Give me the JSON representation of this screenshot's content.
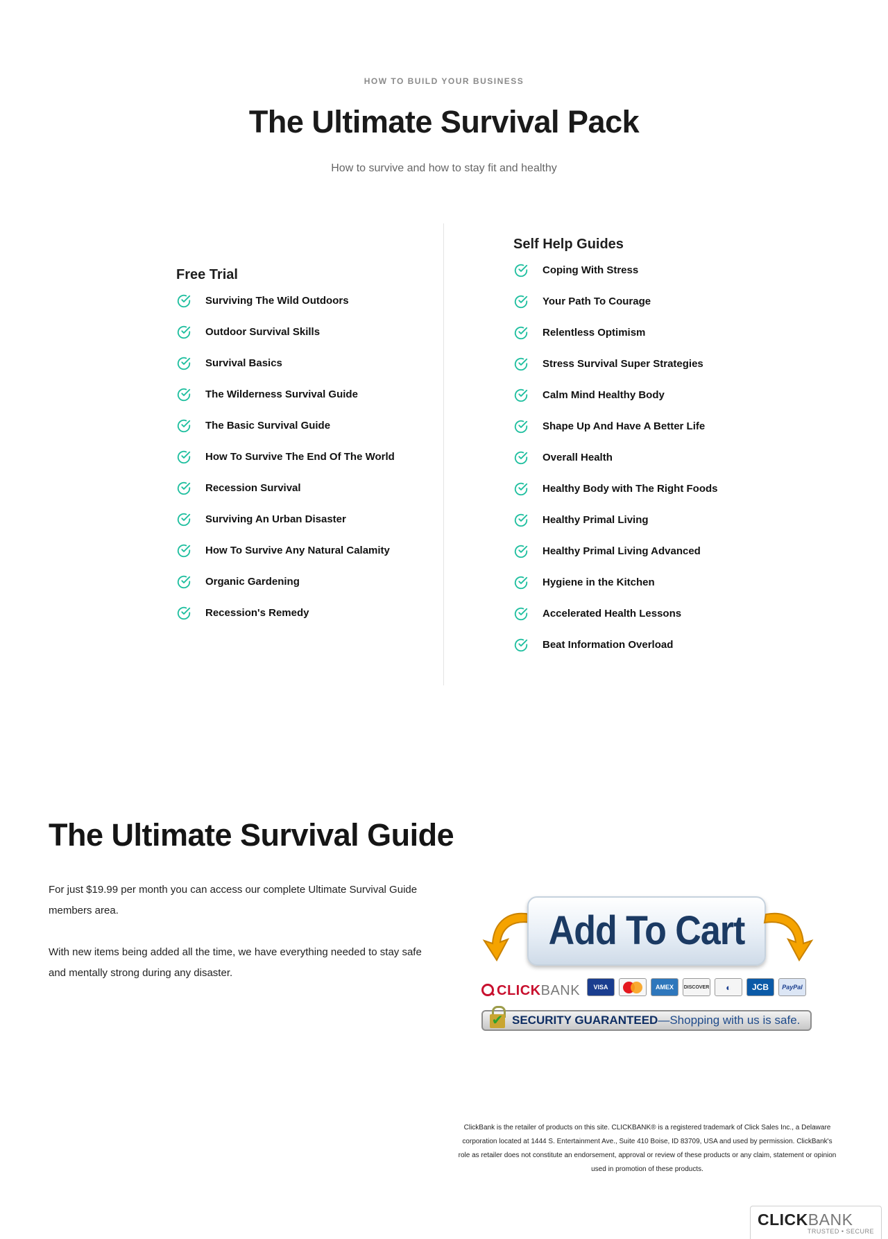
{
  "hero": {
    "eyebrow": "HOW TO BUILD YOUR BUSINESS",
    "title": "The Ultimate Survival Pack",
    "subtitle": "How to survive and how to stay fit and healthy"
  },
  "free_trial": {
    "title": "Free Trial",
    "items": [
      "Surviving The Wild Outdoors",
      "Outdoor Survival Skills",
      "Survival Basics",
      "The Wilderness Survival Guide",
      "The Basic Survival Guide",
      "How To Survive The End Of The World",
      "Recession Survival",
      "Surviving An Urban Disaster",
      "How To Survive Any Natural Calamity",
      "Organic Gardening",
      "Recession's Remedy"
    ]
  },
  "self_help": {
    "title": "Self Help Guides",
    "items": [
      "Coping With Stress",
      "Your Path To Courage",
      "Relentless Optimism",
      "Stress Survival Super Strategies",
      "Calm Mind Healthy Body",
      "Shape Up And Have A Better Life",
      "Overall Health",
      "Healthy Body with The Right Foods",
      "Healthy Primal Living",
      "Healthy Primal Living Advanced",
      "Hygiene in the Kitchen",
      "Accelerated Health Lessons",
      "Beat Information Overload"
    ]
  },
  "guide": {
    "title": "The Ultimate Survival Guide",
    "paragraph1": "For just $19.99 per month you can access our complete Ultimate Survival Guide members area.",
    "paragraph2": "With new items being added all the  time, we have everything needed to stay safe and mentally strong during any disaster."
  },
  "purchase": {
    "button_label": "Add To Cart",
    "clickbank_brand": "CLICK",
    "clickbank_brand_thin": "BANK",
    "cards": [
      "VISA",
      "MasterCard",
      "AMEX",
      "DISCOVER",
      "Diners",
      "JCB",
      "PayPal"
    ],
    "security_strong": "SECURITY GUARANTEED",
    "security_light": "—Shopping with us is safe."
  },
  "disclaimer": "ClickBank is the retailer of products on this site. CLICKBANK® is a registered trademark of Click Sales Inc., a Delaware corporation located at 1444 S. Entertainment Ave., Suite 410 Boise, ID 83709, USA and used by permission. ClickBank's role as retailer does not constitute an endorsement, approval or review of these products or any claim, statement or opinion used in promotion of these products.",
  "badge": {
    "name_bold": "CLICK",
    "name_thin": "BANK",
    "tagline": "TRUSTED • SECURE"
  },
  "colors": {
    "check_accent": "#1fbf9f",
    "arrow_orange": "#f5a300",
    "clickbank_red": "#c8102e"
  }
}
